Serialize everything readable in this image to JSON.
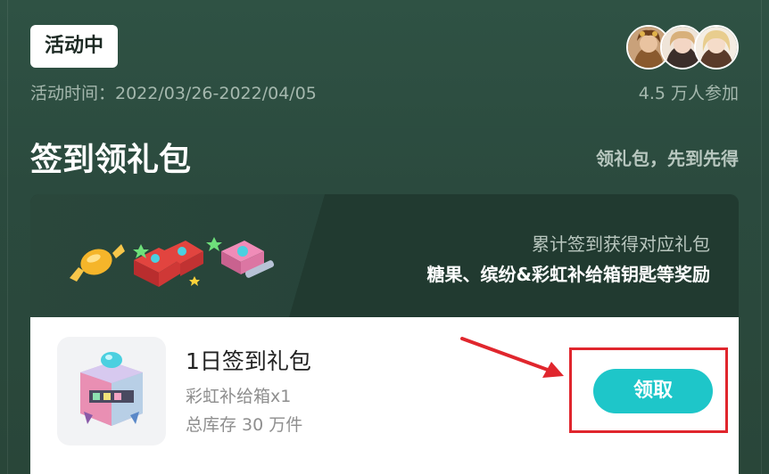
{
  "event": {
    "status": "活动中",
    "time_text": "活动时间：2022/03/26-2022/04/05",
    "participants": "4.5 万人参加"
  },
  "section": {
    "title": "签到领礼包",
    "hint": "领礼包，先到先得"
  },
  "banner": {
    "line1": "累计签到获得对应礼包",
    "line2": "糖果、缤纷&彩虹补给箱钥匙等奖励"
  },
  "reward": {
    "name": "1日签到礼包",
    "item": "彩虹补给箱x1",
    "stock": "总库存 30 万件",
    "button_label": "领取"
  },
  "colors": {
    "background": "#2b4a3e",
    "button": "#1ec6c9",
    "highlight": "#e0262d"
  },
  "icons": [
    "candy-icon",
    "gift-box-icon",
    "key-icon",
    "avatar",
    "rainbow-supply-box-icon"
  ]
}
